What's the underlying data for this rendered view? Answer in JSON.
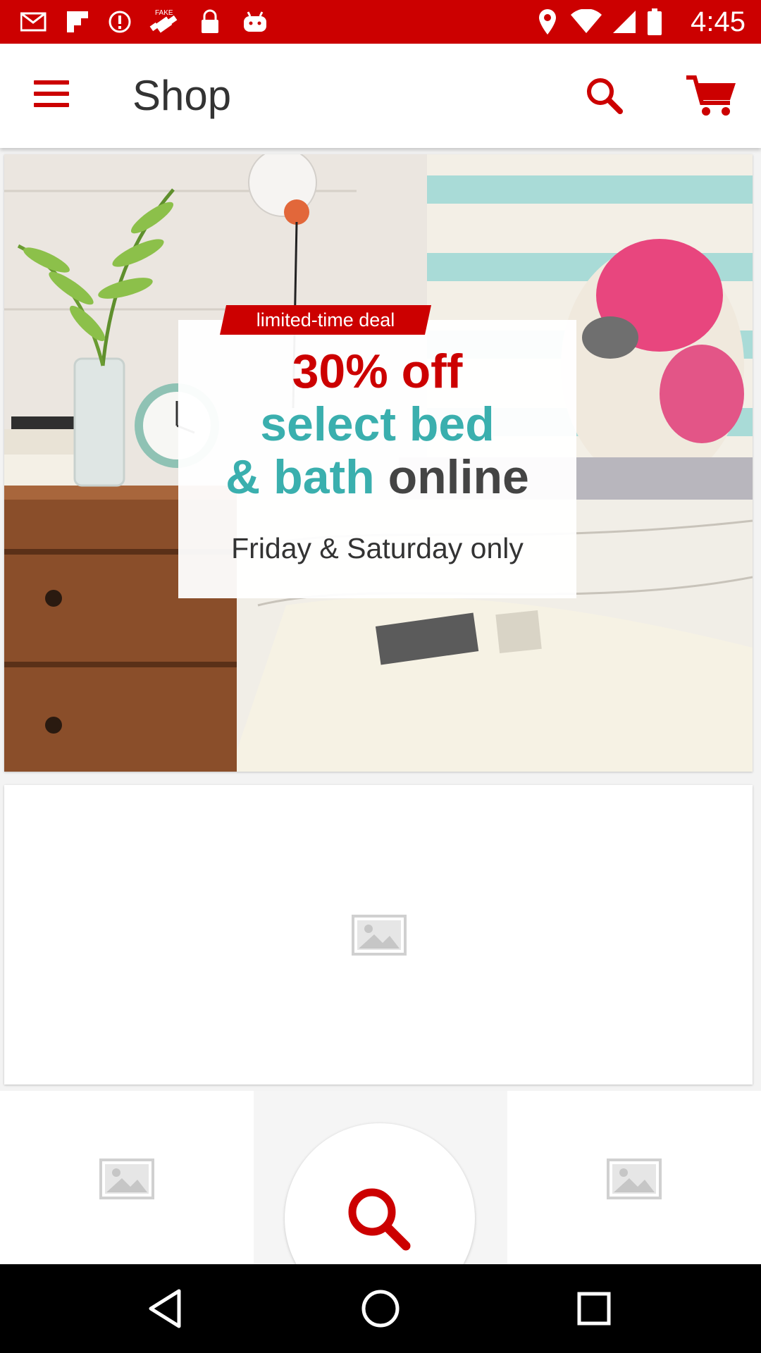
{
  "status_bar": {
    "time": "4:45",
    "left_icons": [
      "mail-icon",
      "flipboard-icon",
      "alert-icon",
      "fake-gps-icon",
      "lock-icon",
      "android-icon"
    ],
    "right_icons": [
      "location-icon",
      "wifi-icon",
      "signal-icon",
      "battery-icon"
    ],
    "fake_label": "FAKE"
  },
  "app_bar": {
    "title": "Shop",
    "menu_icon": "hamburger-menu-icon",
    "search_icon": "search-icon",
    "cart_icon": "cart-icon",
    "accent_color": "#cc0000"
  },
  "hero_banner": {
    "tag": "limited-time deal",
    "line1": "30% off",
    "line2": "select bed",
    "line3a": "& bath",
    "line3b": "online",
    "subtitle": "Friday & Saturday only",
    "colors": {
      "red": "#cc0000",
      "teal": "#3aafae",
      "dark": "#444444"
    }
  },
  "placeholders": {
    "image_icon": "image-placeholder-icon"
  },
  "bottom_tiles": {
    "center_icon": "search-icon"
  },
  "nav_bar": {
    "back_icon": "back-icon",
    "home_icon": "home-icon",
    "recents_icon": "recents-icon"
  }
}
